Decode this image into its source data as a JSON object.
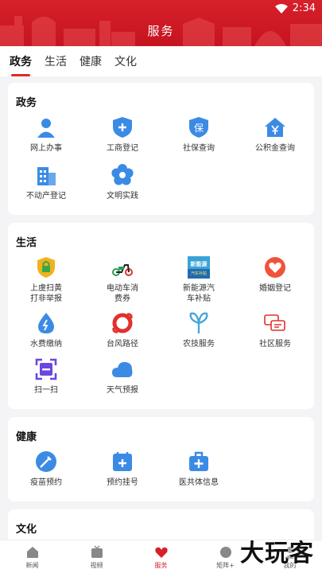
{
  "status": {
    "time": "2:34"
  },
  "header": {
    "title": "服务"
  },
  "tabs": [
    "政务",
    "生活",
    "健康",
    "文化"
  ],
  "sections": [
    {
      "title": "政务",
      "items": [
        {
          "label": "网上办事",
          "icon": "person-icon"
        },
        {
          "label": "工商登记",
          "icon": "shield-plus-icon"
        },
        {
          "label": "社保查询",
          "icon": "shield-bao-icon"
        },
        {
          "label": "公积金查询",
          "icon": "house-yen-icon"
        },
        {
          "label": "不动产登记",
          "icon": "building-icon"
        },
        {
          "label": "文明实践",
          "icon": "flower-icon"
        }
      ]
    },
    {
      "title": "生活",
      "items": [
        {
          "label": "上虞扫黄打非举报",
          "icon": "lock-shield-icon"
        },
        {
          "label": "电动车消费券",
          "icon": "scooter-icon"
        },
        {
          "label": "新能源汽车补贴",
          "icon": "new-energy-banner-icon"
        },
        {
          "label": "婚姻登记",
          "icon": "heart-icon"
        },
        {
          "label": "水费缴纳",
          "icon": "water-drop-icon"
        },
        {
          "label": "台风路径",
          "icon": "typhoon-icon"
        },
        {
          "label": "农技服务",
          "icon": "leaf-icon"
        },
        {
          "label": "社区服务",
          "icon": "chat-icon"
        },
        {
          "label": "扫一扫",
          "icon": "scan-icon"
        },
        {
          "label": "天气预报",
          "icon": "cloud-icon"
        }
      ]
    },
    {
      "title": "健康",
      "items": [
        {
          "label": "疫苗预约",
          "icon": "syringe-icon"
        },
        {
          "label": "预约挂号",
          "icon": "calendar-plus-icon"
        },
        {
          "label": "医共体信息",
          "icon": "medical-kit-icon"
        }
      ]
    },
    {
      "title": "文化",
      "items": []
    }
  ],
  "banner_text": {
    "line1": "新能源",
    "line2": "汽车补贴"
  },
  "bottom_nav": [
    {
      "label": "新闻",
      "icon": "home-icon"
    },
    {
      "label": "视频",
      "icon": "tv-icon"
    },
    {
      "label": "服务",
      "icon": "heart-hand-icon"
    },
    {
      "label": "矩阵+",
      "icon": "matrix-icon"
    },
    {
      "label": "我的",
      "icon": "user-icon"
    }
  ],
  "watermark": "大玩客",
  "colors": {
    "brand_red": "#d6202a",
    "icon_blue": "#3b8be5"
  }
}
